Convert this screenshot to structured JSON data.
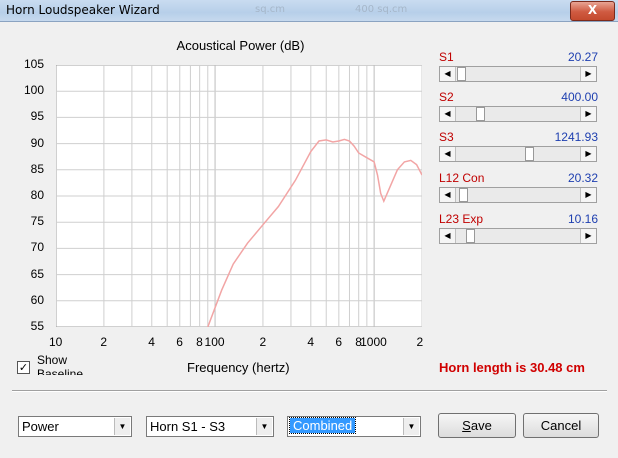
{
  "window": {
    "title": "Horn Loudspeaker Wizard",
    "ghost_text_1": "sq.cm",
    "ghost_text_2": "400 sq.cm",
    "close_label": "X"
  },
  "chart_data": {
    "type": "line",
    "title": "Acoustical Power (dB)",
    "xlabel": "Frequency (hertz)",
    "ylabel": "",
    "x_scale": "log",
    "xlim": [
      10,
      2000
    ],
    "ylim": [
      55,
      105
    ],
    "yticks": [
      "105",
      "100",
      "95",
      "90",
      "85",
      "80",
      "75",
      "70",
      "65",
      "60",
      "55"
    ],
    "xticks": [
      "10",
      "2",
      "4",
      "6",
      "8",
      "100",
      "2",
      "4",
      "6",
      "8",
      "1000",
      "2"
    ],
    "grid": true,
    "series": [
      {
        "color": "#f2a5a5",
        "x": [
          90,
          110,
          130,
          160,
          200,
          250,
          320,
          400,
          450,
          500,
          550,
          600,
          650,
          700,
          750,
          800,
          900,
          1000,
          1050,
          1100,
          1150,
          1250,
          1400,
          1550,
          1700,
          1850,
          2000
        ],
        "y": [
          55,
          62,
          67,
          71,
          74.5,
          78,
          83,
          88.5,
          90.5,
          90.7,
          90.3,
          90.5,
          90.8,
          90.5,
          89.5,
          88.2,
          87.3,
          86.5,
          84,
          80.5,
          79,
          81.5,
          85,
          86.5,
          86.8,
          86,
          84
        ]
      }
    ]
  },
  "controls": {
    "show_baseline_label": "Show Baseline",
    "show_baseline_checked": "✓",
    "params": [
      {
        "label": "S1",
        "value": "20.27",
        "position": 0.02
      },
      {
        "label": "S2",
        "value": "400.00",
        "position": 0.18
      },
      {
        "label": "S3",
        "value": "1241.93",
        "position": 0.6
      },
      {
        "label": "L12  Con",
        "value": "20.32",
        "position": 0.03
      },
      {
        "label": "L23  Exp",
        "value": "10.16",
        "position": 0.09
      }
    ],
    "horn_length": "Horn length is 30.48 cm"
  },
  "bottom": {
    "combo_power": "Power",
    "combo_horn": "Horn S1 - S3",
    "combo_mode": "Combined",
    "save_label": "ave",
    "save_mnemonic": "S",
    "cancel_label": "Cancel"
  }
}
